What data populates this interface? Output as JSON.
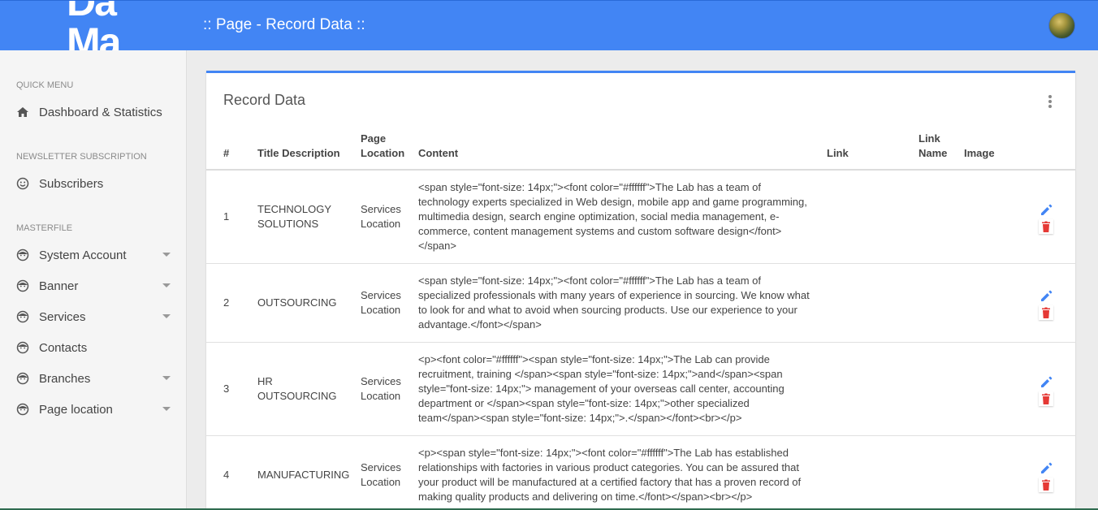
{
  "header": {
    "logo_line1": "Da",
    "logo_line2": "Ma",
    "page_title": ":: Page - Record Data ::"
  },
  "sidebar": {
    "sections": [
      {
        "title": "QUICK MENU"
      },
      {
        "title": "NEWSLETTER SUBSCRIPTION"
      },
      {
        "title": "MASTERFILE"
      }
    ],
    "items": [
      {
        "label": "Dashboard & Statistics",
        "icon": "home-icon"
      },
      {
        "label": "Subscribers",
        "icon": "smiley-icon"
      },
      {
        "label": "System Account",
        "icon": "face-icon"
      },
      {
        "label": "Banner",
        "icon": "face-icon"
      },
      {
        "label": "Services",
        "icon": "face-icon"
      },
      {
        "label": "Contacts",
        "icon": "face-icon"
      },
      {
        "label": "Branches",
        "icon": "face-icon"
      },
      {
        "label": "Page location",
        "icon": "face-icon"
      }
    ]
  },
  "card": {
    "title": "Record Data"
  },
  "table": {
    "headers": {
      "num": "#",
      "title": "Title Description",
      "page_location_1": "Page",
      "page_location_2": "Location",
      "content": "Content",
      "link": "Link",
      "link_name_1": "Link",
      "link_name_2": "Name",
      "image": "Image"
    },
    "rows": [
      {
        "num": "1",
        "title_1": "TECHNOLOGY",
        "title_2": "SOLUTIONS",
        "loc_1": "Services",
        "loc_2": "Location",
        "content": "<span style=\"font-size: 14px;\"><font color=\"#ffffff\">The Lab has a team of technology experts specialized in Web design, mobile app and game programming, multimedia design, search engine optimization, social media management, e-commerce, content management systems and custom software design</font></span>"
      },
      {
        "num": "2",
        "title_1": "OUTSOURCING",
        "title_2": "",
        "loc_1": "Services",
        "loc_2": "Location",
        "content": "<span style=\"font-size: 14px;\"><font color=\"#ffffff\">The Lab has a team of specialized professionals with many years of experience in sourcing. We know what to look for and what to avoid when sourcing products. Use our experience to your advantage.</font></span>"
      },
      {
        "num": "3",
        "title_1": "HR",
        "title_2": "OUTSOURCING",
        "loc_1": "Services",
        "loc_2": "Location",
        "content": "<p><font color=\"#ffffff\"><span style=\"font-size: 14px;\">The Lab can provide recruitment, training </span><span style=\"font-size: 14px;\">and</span><span style=\"font-size: 14px;\"> management of your overseas call center, accounting department or </span><span style=\"font-size: 14px;\">other specialized team</span><span style=\"font-size: 14px;\">.</span></font><br></p>"
      },
      {
        "num": "4",
        "title_1": "MANUFACTURING",
        "title_2": "",
        "loc_1": "Services",
        "loc_2": "Location",
        "content": "<p><span style=\"font-size: 14px;\"><font color=\"#ffffff\">The Lab has established relationships with factories in various product categories. You can be assured that your product will be manufactured at a certified factory that has a proven record of making quality products and delivering on time.</font></span><br></p>"
      }
    ]
  },
  "colors": {
    "header_bg": "#4285f4",
    "edit_icon": "#4285f4",
    "delete_icon": "#e53935"
  }
}
